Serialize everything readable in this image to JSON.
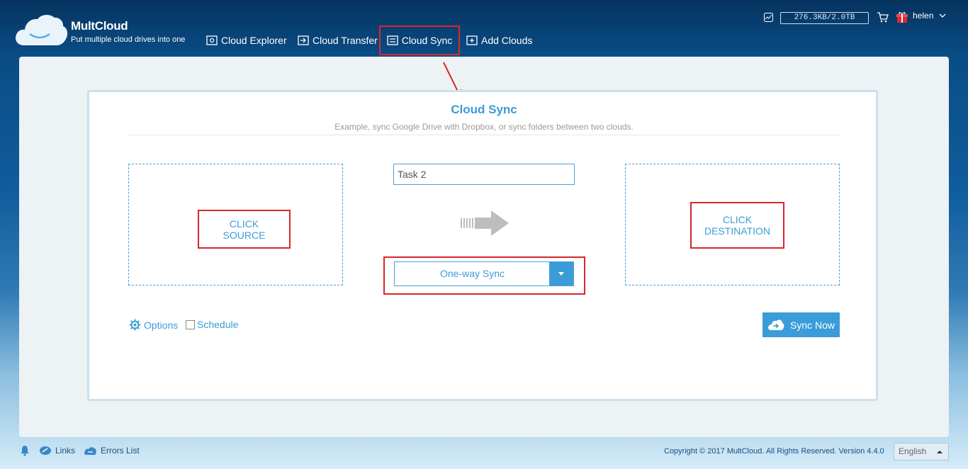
{
  "app": {
    "brand": "MultCloud",
    "tagline": "Put multiple cloud drives into one"
  },
  "nav": {
    "items": [
      {
        "label": "Cloud Explorer",
        "icon": "cloud-explorer-icon"
      },
      {
        "label": "Cloud Transfer",
        "icon": "cloud-transfer-icon"
      },
      {
        "label": "Cloud Sync",
        "icon": "cloud-sync-icon",
        "highlighted": true
      },
      {
        "label": "Add Clouds",
        "icon": "add-clouds-icon"
      }
    ]
  },
  "user": {
    "quota": "276.3KB/2.0TB",
    "name": "helen"
  },
  "page": {
    "title": "Cloud Sync",
    "subtitle": "Example, sync Google Drive with Dropbox, or sync folders between two clouds."
  },
  "source": {
    "line1": "CLICK",
    "line2": "SOURCE"
  },
  "destination": {
    "line1": "CLICK",
    "line2": "DESTINATION"
  },
  "task": {
    "name": "Task 2"
  },
  "sync_mode": {
    "selected": "One-way Sync"
  },
  "options_label": "Options",
  "schedule_label": "Schedule",
  "sync_now_label": "Sync Now",
  "footer": {
    "links_label": "Links",
    "errors_label": "Errors List",
    "copyright": "Copyright © 2017 MultCloud. All Rights Reserved. Version 4.4.0",
    "language": "English"
  },
  "colors": {
    "accent": "#3a9cd8",
    "highlight": "#d9262c"
  }
}
